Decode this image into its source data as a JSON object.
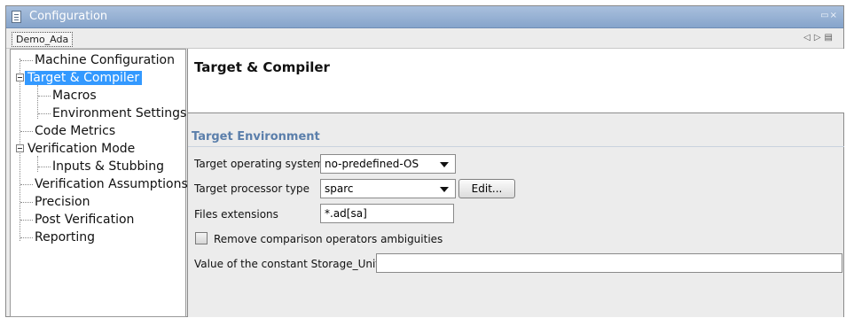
{
  "window": {
    "title": "Configuration",
    "controls": "▭×"
  },
  "tabbar": {
    "active_tab": "Demo_Ada",
    "nav_glyphs": "◁▷▤"
  },
  "tree": {
    "items": [
      {
        "label": "Machine Configuration"
      },
      {
        "label": "Target & Compiler",
        "selected": true,
        "expanded": true
      },
      {
        "label": "Macros"
      },
      {
        "label": "Environment Settings"
      },
      {
        "label": "Code Metrics"
      },
      {
        "label": "Verification Mode",
        "expanded": true
      },
      {
        "label": "Inputs & Stubbing"
      },
      {
        "label": "Verification Assumptions"
      },
      {
        "label": "Precision"
      },
      {
        "label": "Post Verification"
      },
      {
        "label": "Reporting"
      }
    ]
  },
  "main": {
    "title": "Target & Compiler",
    "section_title": "Target Environment",
    "target_os": {
      "label": "Target operating system",
      "value": "no-predefined-OS"
    },
    "target_processor": {
      "label": "Target processor type",
      "value": "sparc",
      "edit_label": "Edit..."
    },
    "files_extensions": {
      "label": "Files extensions",
      "value": "*.ad[sa]"
    },
    "remove_comparison": {
      "label": "Remove comparison operators ambiguities",
      "checked": false
    },
    "storage_unit": {
      "label": "Value of the constant Storage_Unit",
      "value": ""
    }
  },
  "colors": {
    "selection": "#3399ff",
    "section_title": "#5b7fab",
    "titlebar": "#95afd4"
  }
}
